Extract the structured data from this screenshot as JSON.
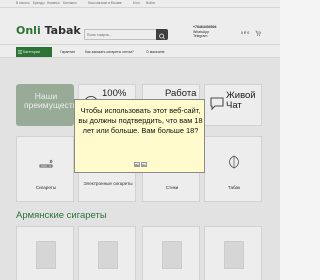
{
  "topbar": {
    "links": [
      "В начало",
      "Бренды",
      "Новинки",
      "Контакты",
      "Наш магазин в Москве",
      "Блог",
      "Войти"
    ]
  },
  "header": {
    "logo_word1": "Onli",
    "logo_word2": "Tabak",
    "search_placeholder": "Поиск товаров...",
    "phone": "+78464404504",
    "contact_line2": "WhatsApp",
    "contact_line3": "Telegram",
    "cart_text": "0 ₽ 0"
  },
  "nav": {
    "catalog_label": "Категории",
    "items": [
      "Гарантии",
      "Как заказать сигареты оптом?",
      "О магазине"
    ]
  },
  "features": {
    "main_label": "Наши преимущества",
    "items": [
      "100% Оригинал",
      "Работа с Юр. лицами",
      "Живой Чат"
    ]
  },
  "categories": [
    "Сигареты",
    "Электронные сигареты",
    "Стики",
    "Табак"
  ],
  "section_title": "Армянские сигареты",
  "modal": {
    "text": "Чтобы использовать этот веб-сайт, вы должны подтвердить, что вам 18 лет или больше. Вам больше 18?",
    "yes_label": "Да",
    "no_label": "Нет"
  },
  "colors": {
    "brand_green": "#2f7d3a",
    "modal_bg": "#fffbcc"
  }
}
